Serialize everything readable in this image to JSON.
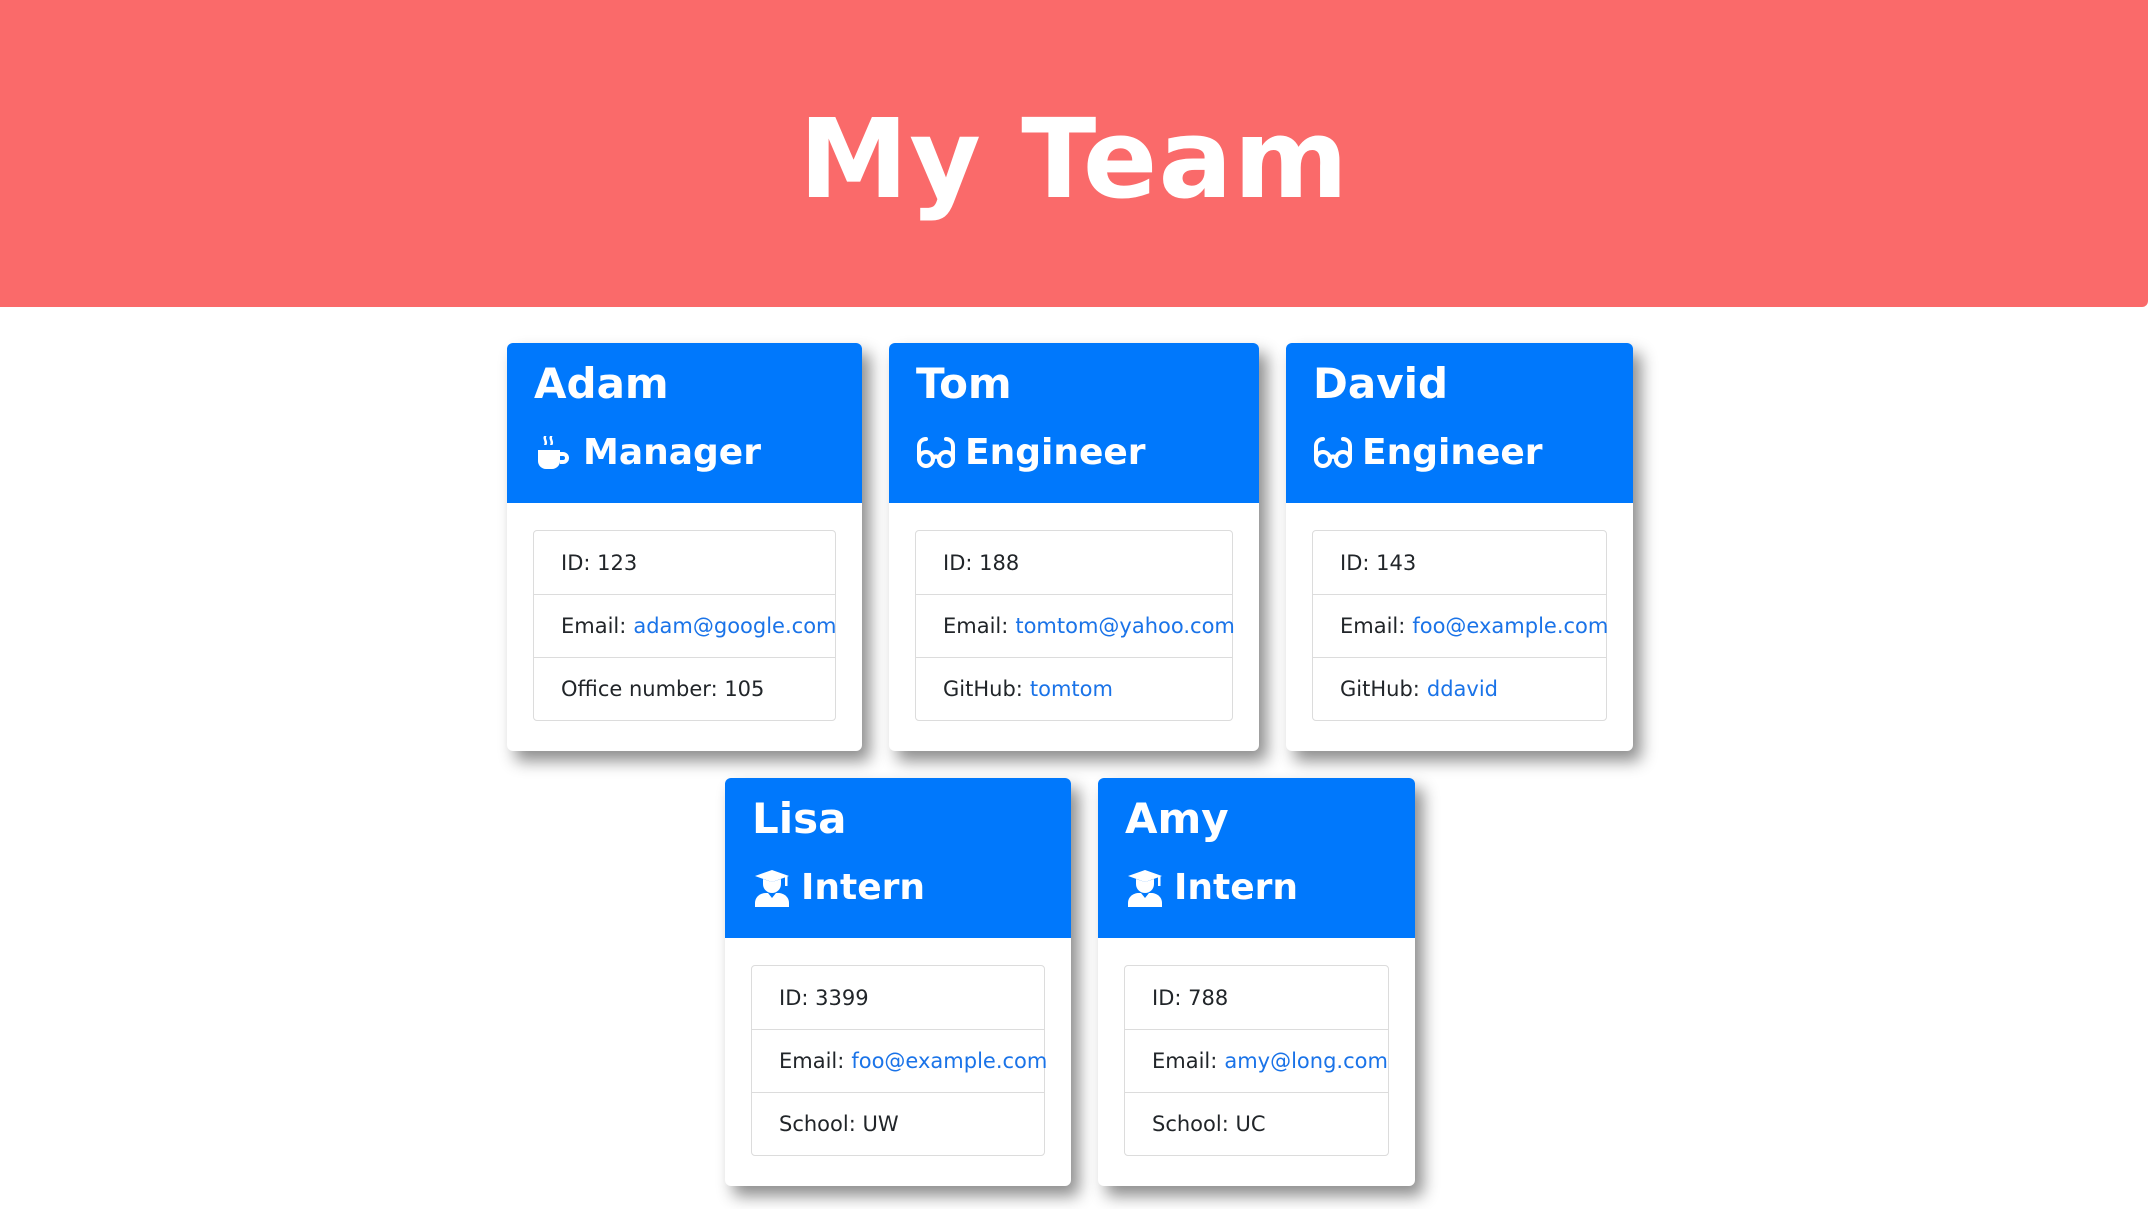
{
  "header": {
    "title": "My Team",
    "color": "#fa6a6a"
  },
  "accent": "#0078fc",
  "link_color": "#1a73e8",
  "employees": [
    {
      "name": "Adam",
      "role": "Manager",
      "icon": "mug-icon",
      "id_label": "ID: 123",
      "email_label": "Email:",
      "email": "adam@google.com",
      "extra_label": "Office number: 105"
    },
    {
      "name": "Tom",
      "role": "Engineer",
      "icon": "glasses-icon",
      "id_label": "ID: 188",
      "email_label": "Email:",
      "email": "tomtom@yahoo.com",
      "extra_label": "GitHub:",
      "extra_link": "tomtom"
    },
    {
      "name": "David",
      "role": "Engineer",
      "icon": "glasses-icon",
      "id_label": "ID: 143",
      "email_label": "Email:",
      "email": "foo@example.com",
      "extra_label": "GitHub:",
      "extra_link": "ddavid"
    },
    {
      "name": "Lisa",
      "role": "Intern",
      "icon": "graduate-icon",
      "id_label": "ID: 3399",
      "email_label": "Email:",
      "email": "foo@example.com",
      "extra_label": "School: UW"
    },
    {
      "name": "Amy",
      "role": "Intern",
      "icon": "graduate-icon",
      "id_label": "ID: 788",
      "email_label": "Email:",
      "email": "amy@long.com",
      "extra_label": "School: UC"
    }
  ]
}
